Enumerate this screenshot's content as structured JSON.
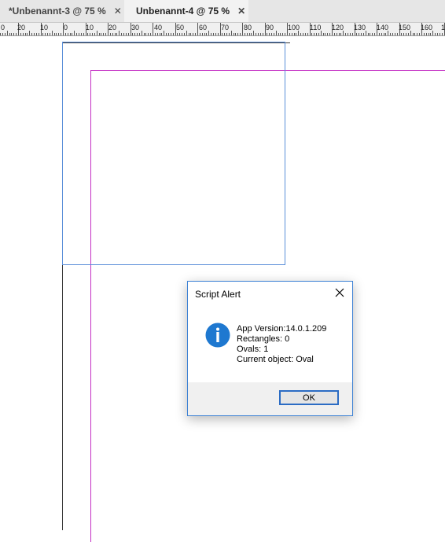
{
  "tabs": [
    {
      "label": "*Unbenannt-3 @ 75 %",
      "close": "✕",
      "active": false
    },
    {
      "label": "Unbenannt-4 @ 75 %",
      "close": "✕",
      "active": true
    }
  ],
  "ruler": {
    "labels": [
      "0",
      "20",
      "10",
      "0",
      "10",
      "20",
      "30",
      "40",
      "50",
      "60",
      "70",
      "80",
      "90",
      "100",
      "110",
      "120",
      "130",
      "140",
      "150",
      "160",
      "1"
    ]
  },
  "dialog": {
    "title": "Script Alert",
    "icon": "info-icon",
    "lines": [
      "App Version:14.0.1.209",
      "Rectangles: 0",
      "Ovals: 1",
      "Current object: Oval"
    ],
    "ok_label": "OK"
  },
  "colors": {
    "accent": "#3b80d4",
    "info_icon": "#1e78d0",
    "magenta_guide": "#c42ec4",
    "blue_frame": "#5b8fd9"
  }
}
